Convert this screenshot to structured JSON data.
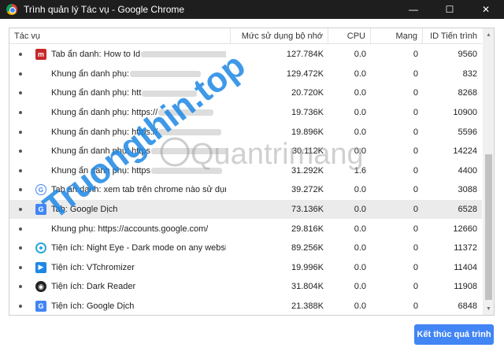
{
  "window": {
    "title": "Trình quản lý Tác vụ - Google Chrome",
    "controls": [
      "—",
      "☐",
      "✕"
    ]
  },
  "table": {
    "headers": [
      "Tác vụ",
      "Mức sử dụng bộ nhớ",
      "CPU",
      "Mạng",
      "ID Tiến trình"
    ],
    "rows": [
      {
        "icon": "red-tab-icon",
        "task": "Tab ẩn danh: How to Id",
        "mem": "127.784K",
        "cpu": "0.0",
        "net": "0",
        "pid": "9560"
      },
      {
        "icon": "none",
        "task": "Khung ẩn danh phụ:",
        "mem": "129.472K",
        "cpu": "0.0",
        "net": "0",
        "pid": "832"
      },
      {
        "icon": "none",
        "task": "Khung ẩn danh phụ: htt",
        "mem": "20.720K",
        "cpu": "0.0",
        "net": "0",
        "pid": "8268"
      },
      {
        "icon": "none",
        "task": "Khung ẩn danh phụ: https://",
        "mem": "19.736K",
        "cpu": "0.0",
        "net": "0",
        "pid": "10900"
      },
      {
        "icon": "none",
        "task": "Khung ẩn danh phụ: https://",
        "mem": "19.896K",
        "cpu": "0.0",
        "net": "0",
        "pid": "5596"
      },
      {
        "icon": "none",
        "task": "Khung ẩn danh phụ: https",
        "mem": "30.112K",
        "cpu": "0.0",
        "net": "0",
        "pid": "14224"
      },
      {
        "icon": "none",
        "task": "Khung ẩn danh phụ: https",
        "mem": "31.292K",
        "cpu": "1.6",
        "net": "0",
        "pid": "4400"
      },
      {
        "icon": "google-icon",
        "task": "Tab ẩn danh: xem tab trên chrome nào sử dụng nhiều r...",
        "mem": "39.272K",
        "cpu": "0.0",
        "net": "0",
        "pid": "3088"
      },
      {
        "icon": "translate-icon",
        "task": "Tab: Google Dịch",
        "mem": "73.136K",
        "cpu": "0.0",
        "net": "0",
        "pid": "6528",
        "selected": true
      },
      {
        "icon": "none",
        "task": "Khung phụ: https://accounts.google.com/",
        "mem": "29.816K",
        "cpu": "0.0",
        "net": "0",
        "pid": "12660"
      },
      {
        "icon": "night-eye-icon",
        "task": "Tiện ích: Night Eye - Dark mode on any website",
        "mem": "89.256K",
        "cpu": "0.0",
        "net": "0",
        "pid": "11372"
      },
      {
        "icon": "vtchromizer-icon",
        "task": "Tiện ích: VTchromizer",
        "mem": "19.996K",
        "cpu": "0.0",
        "net": "0",
        "pid": "11404"
      },
      {
        "icon": "dark-reader-icon",
        "task": "Tiện ích: Dark Reader",
        "mem": "31.804K",
        "cpu": "0.0",
        "net": "0",
        "pid": "11908"
      },
      {
        "icon": "translate-icon",
        "task": "Tiện ích: Google Dịch",
        "mem": "21.388K",
        "cpu": "0.0",
        "net": "0",
        "pid": "6848"
      }
    ]
  },
  "end_process_label": "Kết thúc quá trình",
  "watermarks": [
    "Truongthin.top",
    "Quantrimang"
  ],
  "colors": {
    "accent": "#4285f4",
    "titlebar": "#1e1e1e",
    "selected_row": "#ebebeb"
  }
}
